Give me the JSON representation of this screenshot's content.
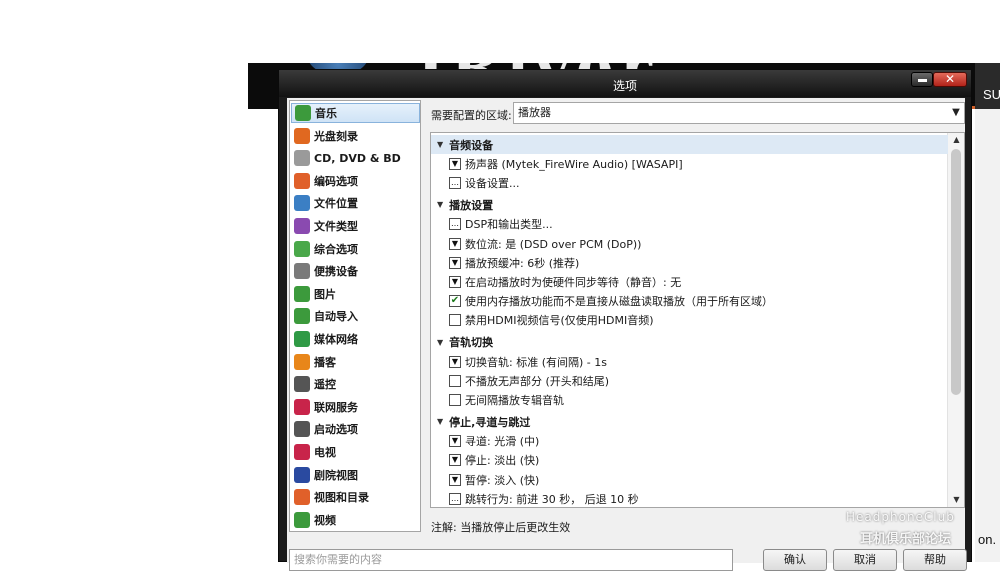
{
  "background": {
    "right_text": "SU",
    "bottom_text": "on."
  },
  "window": {
    "title": "选项"
  },
  "nav": {
    "items": [
      {
        "label": "音乐",
        "icon": "music-icon",
        "color": "#3c9a3c",
        "selected": true
      },
      {
        "label": "光盘刻录",
        "icon": "burn-icon",
        "color": "#e06820"
      },
      {
        "label": "CD, DVD & BD",
        "icon": "disc-icon",
        "color": "#9a9a9a"
      },
      {
        "label": "编码选项",
        "icon": "encode-icon",
        "color": "#e0602a"
      },
      {
        "label": "文件位置",
        "icon": "folder-location-icon",
        "color": "#3b7fc4"
      },
      {
        "label": "文件类型",
        "icon": "file-type-icon",
        "color": "#8a4ab0"
      },
      {
        "label": "综合选项",
        "icon": "general-icon",
        "color": "#4aa84a"
      },
      {
        "label": "便携设备",
        "icon": "portable-device-icon",
        "color": "#7a7a7a"
      },
      {
        "label": "图片",
        "icon": "picture-icon",
        "color": "#3c9a3c"
      },
      {
        "label": "自动导入",
        "icon": "auto-import-icon",
        "color": "#3c9a3c"
      },
      {
        "label": "媒体网络",
        "icon": "media-network-icon",
        "color": "#2f9a45"
      },
      {
        "label": "播客",
        "icon": "podcast-icon",
        "color": "#e8861a"
      },
      {
        "label": "遥控",
        "icon": "remote-icon",
        "color": "#555555"
      },
      {
        "label": "联网服务",
        "icon": "online-service-icon",
        "color": "#c8244a"
      },
      {
        "label": "启动选项",
        "icon": "startup-icon",
        "color": "#555555"
      },
      {
        "label": "电视",
        "icon": "tv-icon",
        "color": "#c8244a"
      },
      {
        "label": "剧院视图",
        "icon": "theater-view-icon",
        "color": "#2a4aa0"
      },
      {
        "label": "视图和目录",
        "icon": "view-catalog-icon",
        "color": "#e0602a"
      },
      {
        "label": "视频",
        "icon": "video-icon",
        "color": "#3c9a3c"
      }
    ]
  },
  "area": {
    "label": "需要配置的区域:",
    "selected": "播放器"
  },
  "settings": {
    "groups": [
      {
        "title": "音频设备",
        "items": [
          {
            "type": "dropdown",
            "label": "扬声器 (Mytek_FireWire Audio) [WASAPI]"
          },
          {
            "type": "dialog",
            "label": "设备设置..."
          }
        ]
      },
      {
        "title": "播放设置",
        "items": [
          {
            "type": "dialog",
            "label": "DSP和输出类型..."
          },
          {
            "type": "dropdown",
            "label": "数位流: 是 (DSD over PCM (DoP))"
          },
          {
            "type": "dropdown",
            "label": "播放预缓冲: 6秒 (推荐)"
          },
          {
            "type": "dropdown",
            "label": "在启动播放时为使硬件同步等待（静音）: 无"
          },
          {
            "type": "checkbox",
            "checked": true,
            "label": "使用内存播放功能而不是直接从磁盘读取播放（用于所有区域）"
          },
          {
            "type": "checkbox",
            "checked": false,
            "label": "禁用HDMI视频信号(仅使用HDMI音频)"
          }
        ]
      },
      {
        "title": "音轨切换",
        "items": [
          {
            "type": "dropdown",
            "label": "切换音轨: 标准 (有间隔) - 1s"
          },
          {
            "type": "checkbox",
            "checked": false,
            "label": "不播放无声部分 (开头和结尾)"
          },
          {
            "type": "checkbox",
            "checked": false,
            "label": "无间隔播放专辑音轨"
          }
        ]
      },
      {
        "title": "停止,寻道与跳过",
        "items": [
          {
            "type": "dropdown",
            "label": "寻道: 光滑 (中)"
          },
          {
            "type": "dropdown",
            "label": "停止: 淡出 (快)"
          },
          {
            "type": "dropdown",
            "label": "暂停: 淡入 (快)"
          },
          {
            "type": "dialog",
            "label": "跳转行为: 前进 30 秒， 后退 10 秒"
          }
        ]
      }
    ]
  },
  "note": "注解: 当播放停止后更改生效",
  "search": {
    "placeholder": "搜索你需要的内容"
  },
  "buttons": {
    "ok": "确认",
    "cancel": "取消",
    "help": "帮助"
  },
  "watermark": {
    "line1": "HeadphoneClub",
    "line2": "耳机俱乐部论坛"
  }
}
